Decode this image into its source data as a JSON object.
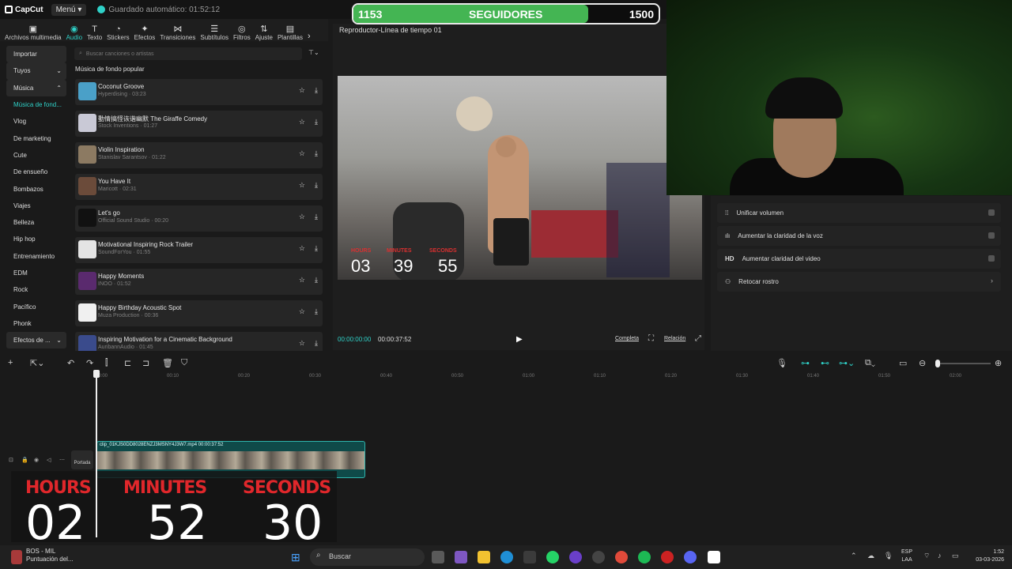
{
  "topbar": {
    "app_name": "CapCut",
    "menu_label": "Menú",
    "autosave": "Guardado automático: 01:52:12"
  },
  "followers": {
    "current": "1153",
    "label": "SEGUIDORES",
    "goal": "1500",
    "progress": 0.77
  },
  "tools": [
    {
      "label": "Archivos multimedia",
      "icon": "media-icon"
    },
    {
      "label": "Audio",
      "icon": "audio-icon",
      "active": true
    },
    {
      "label": "Texto",
      "icon": "text-icon"
    },
    {
      "label": "Stickers",
      "icon": "sticker-icon"
    },
    {
      "label": "Efectos",
      "icon": "effects-icon"
    },
    {
      "label": "Transiciones",
      "icon": "transitions-icon"
    },
    {
      "label": "Subtítulos",
      "icon": "subtitles-icon"
    },
    {
      "label": "Filtros",
      "icon": "filters-icon"
    },
    {
      "label": "Ajuste",
      "icon": "adjust-icon"
    },
    {
      "label": "Plantillas",
      "icon": "templates-icon"
    }
  ],
  "categories": [
    "Importar",
    "Tuyos",
    "Música",
    "Música de fond...",
    "Vlog",
    "De marketing",
    "Cute",
    "De ensueño",
    "Bombazos",
    "Viajes",
    "Belleza",
    "Hip hop",
    "Entrenamiento",
    "EDM",
    "Rock",
    "Pacífico",
    "Phonk",
    "Efectos de ..."
  ],
  "search": {
    "placeholder": "Buscar canciones o artistas"
  },
  "section_title": "Música de fondo popular",
  "songs": [
    {
      "title": "Coconut Groove",
      "meta": "Hyperdising · 03:23",
      "color": "#4aa0c8"
    },
    {
      "title": "動情搞怪诙谐幽默  The Giraffe Comedy",
      "meta": "Stock Inventions · 01:27",
      "color": "#c9c9d6"
    },
    {
      "title": "Violin Inspiration",
      "meta": "Stanislav Sarantsov · 01:22",
      "color": "#8c7a62"
    },
    {
      "title": "You Have It",
      "meta": "Maricott · 02:31",
      "color": "#6b4b3a"
    },
    {
      "title": "Let's go",
      "meta": "Official Sound Studio · 00:20",
      "color": "#111111"
    },
    {
      "title": "Motivational Inspiring Rock Trailer",
      "meta": "SoundForYou · 01:55",
      "color": "#e4e4e4"
    },
    {
      "title": "Happy Moments",
      "meta": "INOO · 01:52",
      "color": "#5a2a6e"
    },
    {
      "title": "Happy Birthday Acoustic Spot",
      "meta": "Muza Production · 00:36",
      "color": "#f0f0f0"
    },
    {
      "title": "Inspiring Motivation for a Cinematic Background",
      "meta": "AuribannAudio · 01:45",
      "color": "#3a4b8c"
    }
  ],
  "player": {
    "title": "Reproductor-Línea de tiempo 01",
    "current_time": "00:00:00:00",
    "total_time": "00:00:37:52",
    "full_label": "Completa",
    "ratio_label": "Relación"
  },
  "video_overlay": {
    "hours_label": "HOURS",
    "minutes_label": "MINUTES",
    "seconds_label": "SECONDS",
    "hours": "03",
    "minutes": "39",
    "seconds": "55"
  },
  "right_options": [
    {
      "label": "Unificar volumen",
      "icon": "volume-icon"
    },
    {
      "label": "Aumentar la claridad de la voz",
      "icon": "voice-icon"
    },
    {
      "label": "Aumentar claridad del video",
      "icon": "hd-icon"
    },
    {
      "label": "Retocar rostro",
      "icon": "face-icon"
    }
  ],
  "timeline": {
    "ticks": [
      "00:00",
      "00:10",
      "00:20",
      "00:30",
      "00:40",
      "00:50",
      "01:00",
      "01:10",
      "01:20",
      "01:30",
      "01:40",
      "01:50",
      "02:00"
    ],
    "clip_label": "clip_01KJS0DD8028ENZJ3MSNY4J3W7.mp4   00:00:37:52",
    "cover_label": "Portada"
  },
  "timer": {
    "hours_label": "HOURS",
    "minutes_label": "MINUTES",
    "seconds_label": "SECONDS",
    "hours": "02",
    "minutes": "52",
    "seconds": "30"
  },
  "taskbar": {
    "game_title": "BOS - MIL",
    "game_sub": "Puntuación del...",
    "search_label": "Buscar",
    "lang_1": "ESP",
    "lang_2": "LAA",
    "time": "1:52",
    "date": "03-03-2026"
  }
}
